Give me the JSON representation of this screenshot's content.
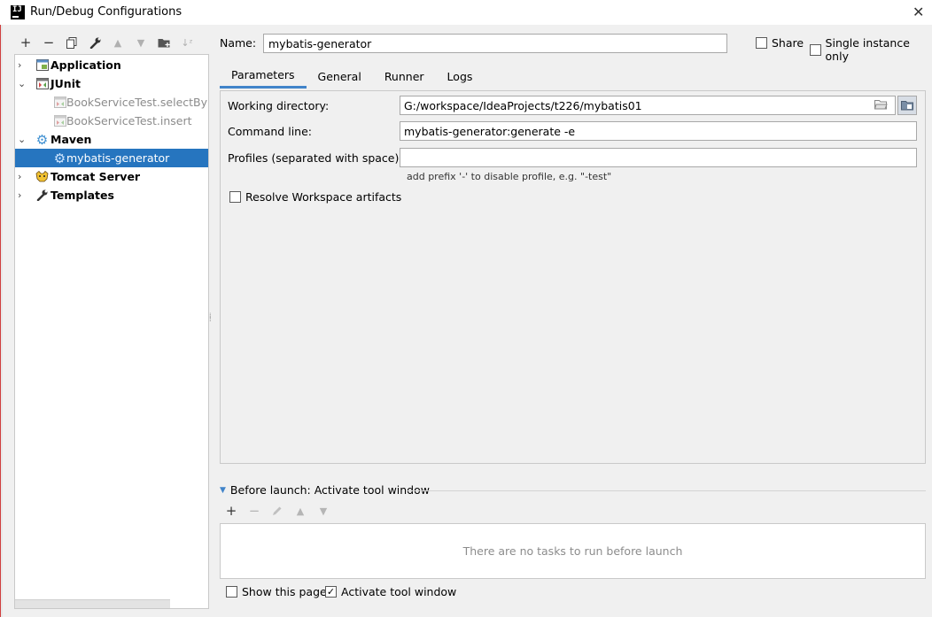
{
  "window": {
    "title": "Run/Debug Configurations",
    "app_icon_text": "IJ"
  },
  "toolbar": {
    "icons": [
      "add-icon",
      "remove-icon",
      "copy-icon",
      "wrench-icon",
      "move-up-icon",
      "move-down-icon",
      "new-folder-icon",
      "sort-icon"
    ]
  },
  "tree": {
    "items": [
      {
        "label": "Application",
        "level": 0,
        "icon": "application-icon",
        "expanded": false
      },
      {
        "label": "JUnit",
        "level": 0,
        "icon": "junit-icon",
        "expanded": true
      },
      {
        "label": "BookServiceTest.selectByPri",
        "level": 1,
        "icon": "test-icon"
      },
      {
        "label": "BookServiceTest.insert",
        "level": 1,
        "icon": "test-icon"
      },
      {
        "label": "Maven",
        "level": 0,
        "icon": "maven-gear-icon",
        "expanded": true
      },
      {
        "label": "mybatis-generator",
        "level": 1,
        "icon": "maven-gear-icon",
        "selected": true
      },
      {
        "label": "Tomcat Server",
        "level": 0,
        "icon": "tomcat-icon",
        "expanded": false
      },
      {
        "label": "Templates",
        "level": 0,
        "icon": "wrench-icon",
        "expanded": false
      }
    ]
  },
  "header": {
    "name_label": "Name:",
    "name_value": "mybatis-generator",
    "share_label": "Share",
    "share_checked": false,
    "single_instance_label": "Single instance only",
    "single_instance_checked": false
  },
  "tabs": [
    "Parameters",
    "General",
    "Runner",
    "Logs"
  ],
  "active_tab": "Parameters",
  "parameters": {
    "working_dir_label": "Working directory:",
    "working_dir_value": "G:/workspace/IdeaProjects/t226/mybatis01",
    "command_line_label": "Command line:",
    "command_line_value": "mybatis-generator:generate -e",
    "profiles_label": "Profiles (separated with space):",
    "profiles_value": "",
    "profiles_hint": "add prefix '-' to disable profile, e.g. \"-test\"",
    "resolve_label": "Resolve Workspace artifacts",
    "resolve_checked": false
  },
  "before_launch": {
    "title": "Before launch: Activate tool window",
    "empty_text": "There are no tasks to run before launch",
    "show_page_label": "Show this page",
    "show_page_checked": false,
    "activate_label": "Activate tool window",
    "activate_checked": true
  },
  "colors": {
    "selection": "#2675bf",
    "tab_underline": "#4083c9",
    "background": "#f0f0f0"
  }
}
